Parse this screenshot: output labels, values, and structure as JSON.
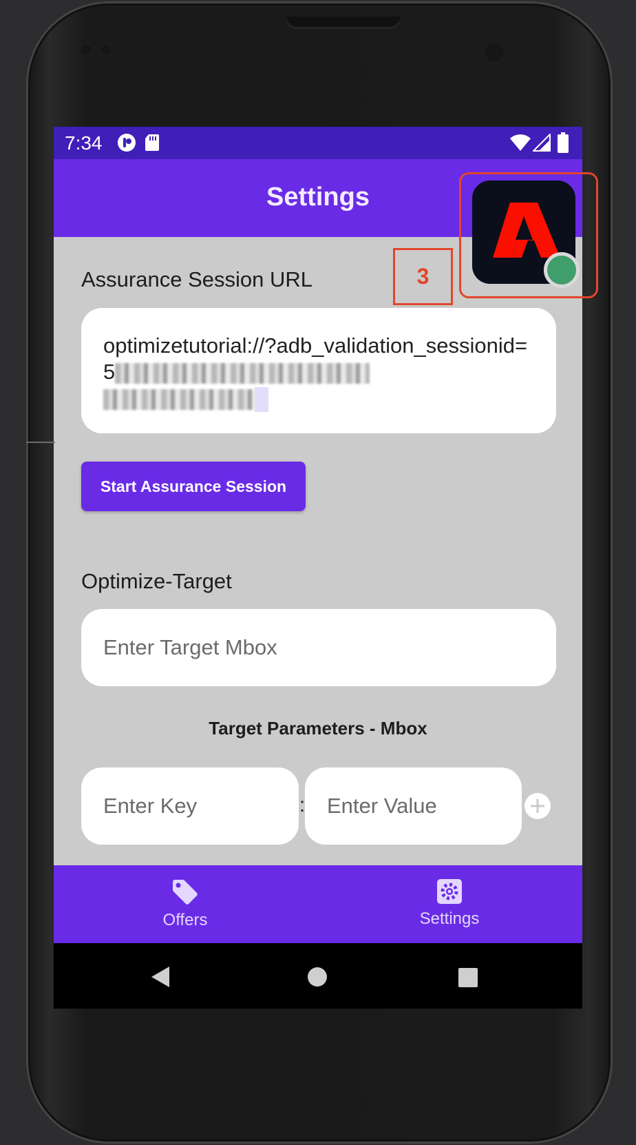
{
  "status_bar": {
    "time": "7:34"
  },
  "app_bar": {
    "title": "Settings"
  },
  "assurance": {
    "section_label": "Assurance Session URL",
    "url_value_visible": "optimizetutorial://?adb_validation_sessionid=5",
    "start_button_label": "Start Assurance Session"
  },
  "annotation": {
    "step_number": "3",
    "color": "#e2462c"
  },
  "target": {
    "section_label": "Optimize-Target",
    "mbox_placeholder": "Enter Target Mbox",
    "params_label": "Target Parameters - Mbox",
    "key_placeholder": "Enter Key",
    "separator": ":",
    "value_placeholder": "Enter Value"
  },
  "bottom_nav": {
    "items": [
      {
        "label": "Offers",
        "icon": "tag-icon"
      },
      {
        "label": "Settings",
        "icon": "gear-icon"
      }
    ]
  },
  "colors": {
    "primary": "#6a2be6",
    "status_bar": "#3f1fb8",
    "background": "#cbcbcb",
    "adobe_red": "#fa0f00",
    "connected_green": "#3f9e6c"
  }
}
